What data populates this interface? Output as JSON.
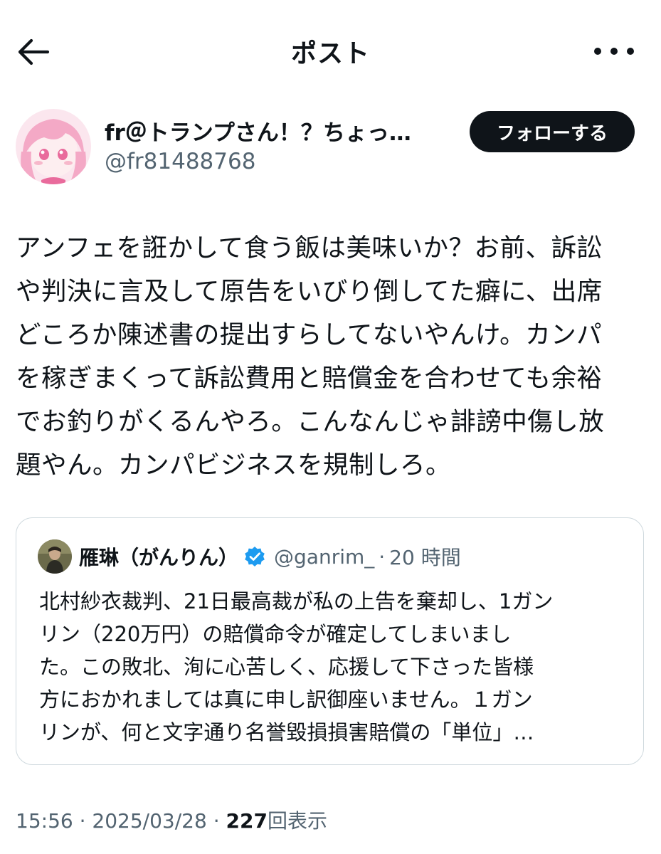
{
  "header": {
    "title": "ポスト",
    "back_icon": "arrow-left-icon",
    "more_icon": "more-horizontal-icon"
  },
  "author": {
    "name": "fr＠トランプさん！？ちょっ…",
    "handle": "@fr81488768",
    "follow_label": "フォローする"
  },
  "post": {
    "lines": [
      "アンフェを誑かして食う飯は美味いか？お前、訴訟",
      "や判決に言及して原告をいびり倒してた癖に、出席",
      "どころか陳述書の提出すらしてないやんけ。カンパ",
      "を稼ぎまくって訴訟費用と賠償金を合わせても余裕",
      "でお釣りがくるんやろ。こんなんじゃ誹謗中傷し放",
      "題やん。カンパビジネスを規制しろ。"
    ]
  },
  "quote": {
    "name": "雁琳（がんりん）",
    "verified_icon": "verified-badge-icon",
    "handle": "@ganrim_",
    "separator": "·",
    "time": "20 時間",
    "lines": [
      "北村紗衣裁判、21日最高裁が私の上告を棄却し、1ガン",
      "リン（220万円）の賠償命令が確定してしまいまし",
      "た。この敗北、洵に心苦しく、応援して下さった皆様",
      "方におかれましては真に申し訳御座いません。１ガン",
      "リンが、何と文字通り名誉毀損損害賠償の「単位」…"
    ]
  },
  "meta": {
    "time": "15:56",
    "sep1": " · ",
    "date": "2025/03/28",
    "sep2": " · ",
    "views": "227",
    "views_label": "回表示"
  },
  "colors": {
    "text": "#0f1419",
    "secondary": "#536471",
    "border": "#cfd9de",
    "verified": "#1d9bf0"
  }
}
